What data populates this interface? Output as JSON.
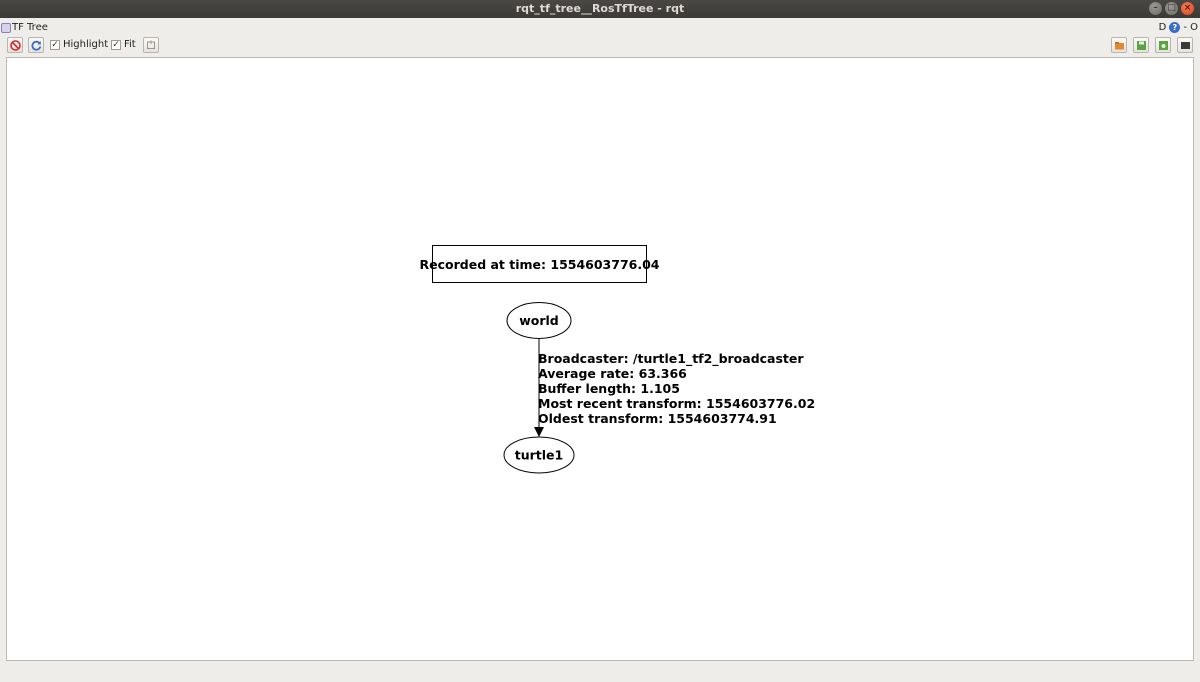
{
  "window": {
    "title": "rqt_tf_tree__RosTfTree - rqt"
  },
  "plugin": {
    "title": "TF Tree",
    "right_label_d": "D",
    "right_label_o": "- O"
  },
  "toolbar": {
    "highlight_label": "Highlight",
    "fit_label": "Fit"
  },
  "graph": {
    "recorded_label": "Recorded at time: 1554603776.04",
    "nodes": [
      "world",
      "turtle1"
    ],
    "edge_info": [
      "Broadcaster: /turtle1_tf2_broadcaster",
      "Average rate: 63.366",
      "Buffer length: 1.105",
      "Most recent transform: 1554603776.02",
      "Oldest transform: 1554603774.91"
    ]
  },
  "colors": {
    "clear_icon": "#d62c2c",
    "refresh_icon": "#3b6cc6",
    "open_icon": "#e08a2e",
    "save_icon": "#5aa342"
  }
}
